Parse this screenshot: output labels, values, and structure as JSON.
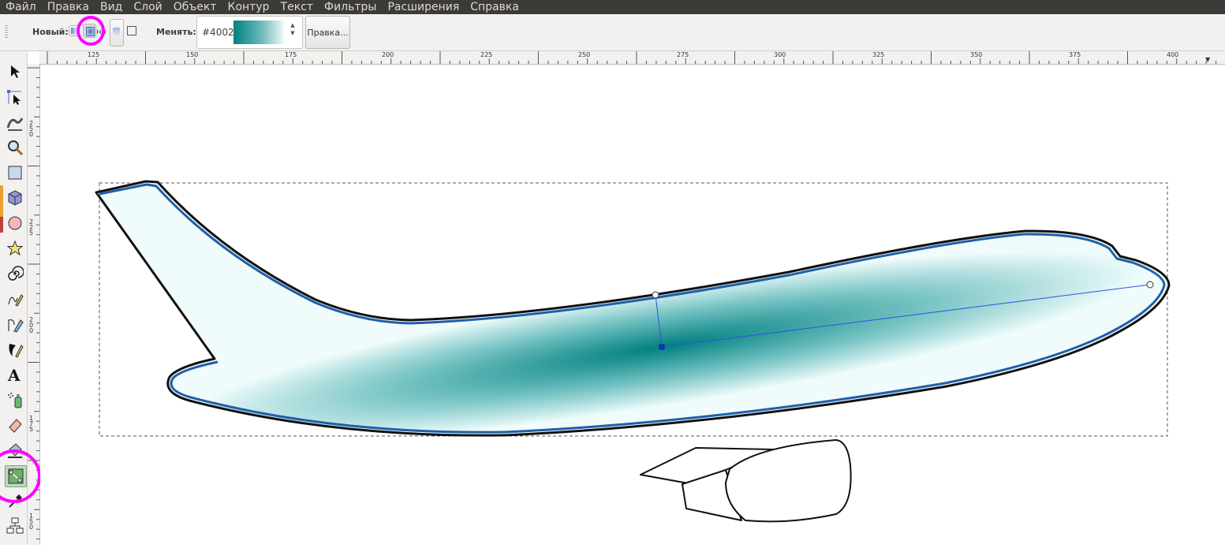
{
  "menubar": {
    "items": [
      "Файл",
      "Правка",
      "Вид",
      "Слой",
      "Объект",
      "Контур",
      "Текст",
      "Фильтры",
      "Расширения",
      "Справка"
    ]
  },
  "toolbar": {
    "new_label": "Новый:",
    "new_option_partial": "на",
    "change_label": "Менять:",
    "gradient_name": "#4002",
    "edit_button": "Правка..."
  },
  "ruler": {
    "h_ticks": [
      "125",
      "150",
      "175",
      "200",
      "225",
      "250",
      "275",
      "300",
      "325",
      "350",
      "375",
      "400"
    ],
    "v_ticks": [
      "250",
      "225",
      "200",
      "175",
      "150"
    ]
  },
  "gradient": {
    "start_color": "#008080",
    "end_color": "#f0fcfc",
    "outline_color": "#1f5faa"
  },
  "annotation_color": "#ff00ff"
}
